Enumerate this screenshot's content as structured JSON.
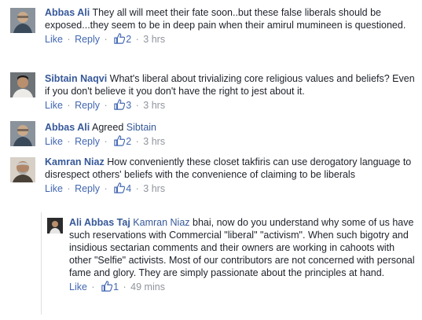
{
  "comments": [
    {
      "name": "Abbas Ali",
      "text": "They all will meet their fate soon..but these false liberals should be exposed...they seem to be in deep pain when their amirul mumineen is questioned.",
      "like": "Like",
      "reply": "Reply",
      "likes": "2",
      "time": "3 hrs"
    },
    {
      "name": "Sibtain Naqvi",
      "text": "What's liberal about trivializing core religious values and beliefs? Even if you don't believe it you don't have the right to jest about it.",
      "like": "Like",
      "reply": "Reply",
      "likes": "3",
      "time": "3 hrs"
    },
    {
      "name": "Abbas Ali",
      "text": "Agreed",
      "tag": "Sibtain",
      "like": "Like",
      "reply": "Reply",
      "likes": "2",
      "time": "3 hrs"
    },
    {
      "name": "Kamran Niaz",
      "text": "How conveniently these closet takfiris can use derogatory language to disrespect others' beliefs with the convenience of claiming to be liberals",
      "like": "Like",
      "reply": "Reply",
      "likes": "4",
      "time": "3 hrs"
    }
  ],
  "reply": {
    "name": "Ali Abbas Taj",
    "tag": "Kamran Niaz",
    "text": "bhai, now do you understand why some of us have such reservations with Commercial \"liberal\" \"activism\". When such bigotry and insidious sectarian comments and their owners are working in cahoots with other \"Selfie\" activists. Most of our contributors are not concerned with personal fame and glory. They are simply passionate about the principles at hand.",
    "like": "Like",
    "likes": "1",
    "time": "49 mins"
  },
  "separator": "·",
  "icons": {
    "like": "thumbs-up-icon"
  },
  "colors": {
    "name": "#365899",
    "link": "#4267b2",
    "meta": "#90949c",
    "text": "#1d2129"
  }
}
